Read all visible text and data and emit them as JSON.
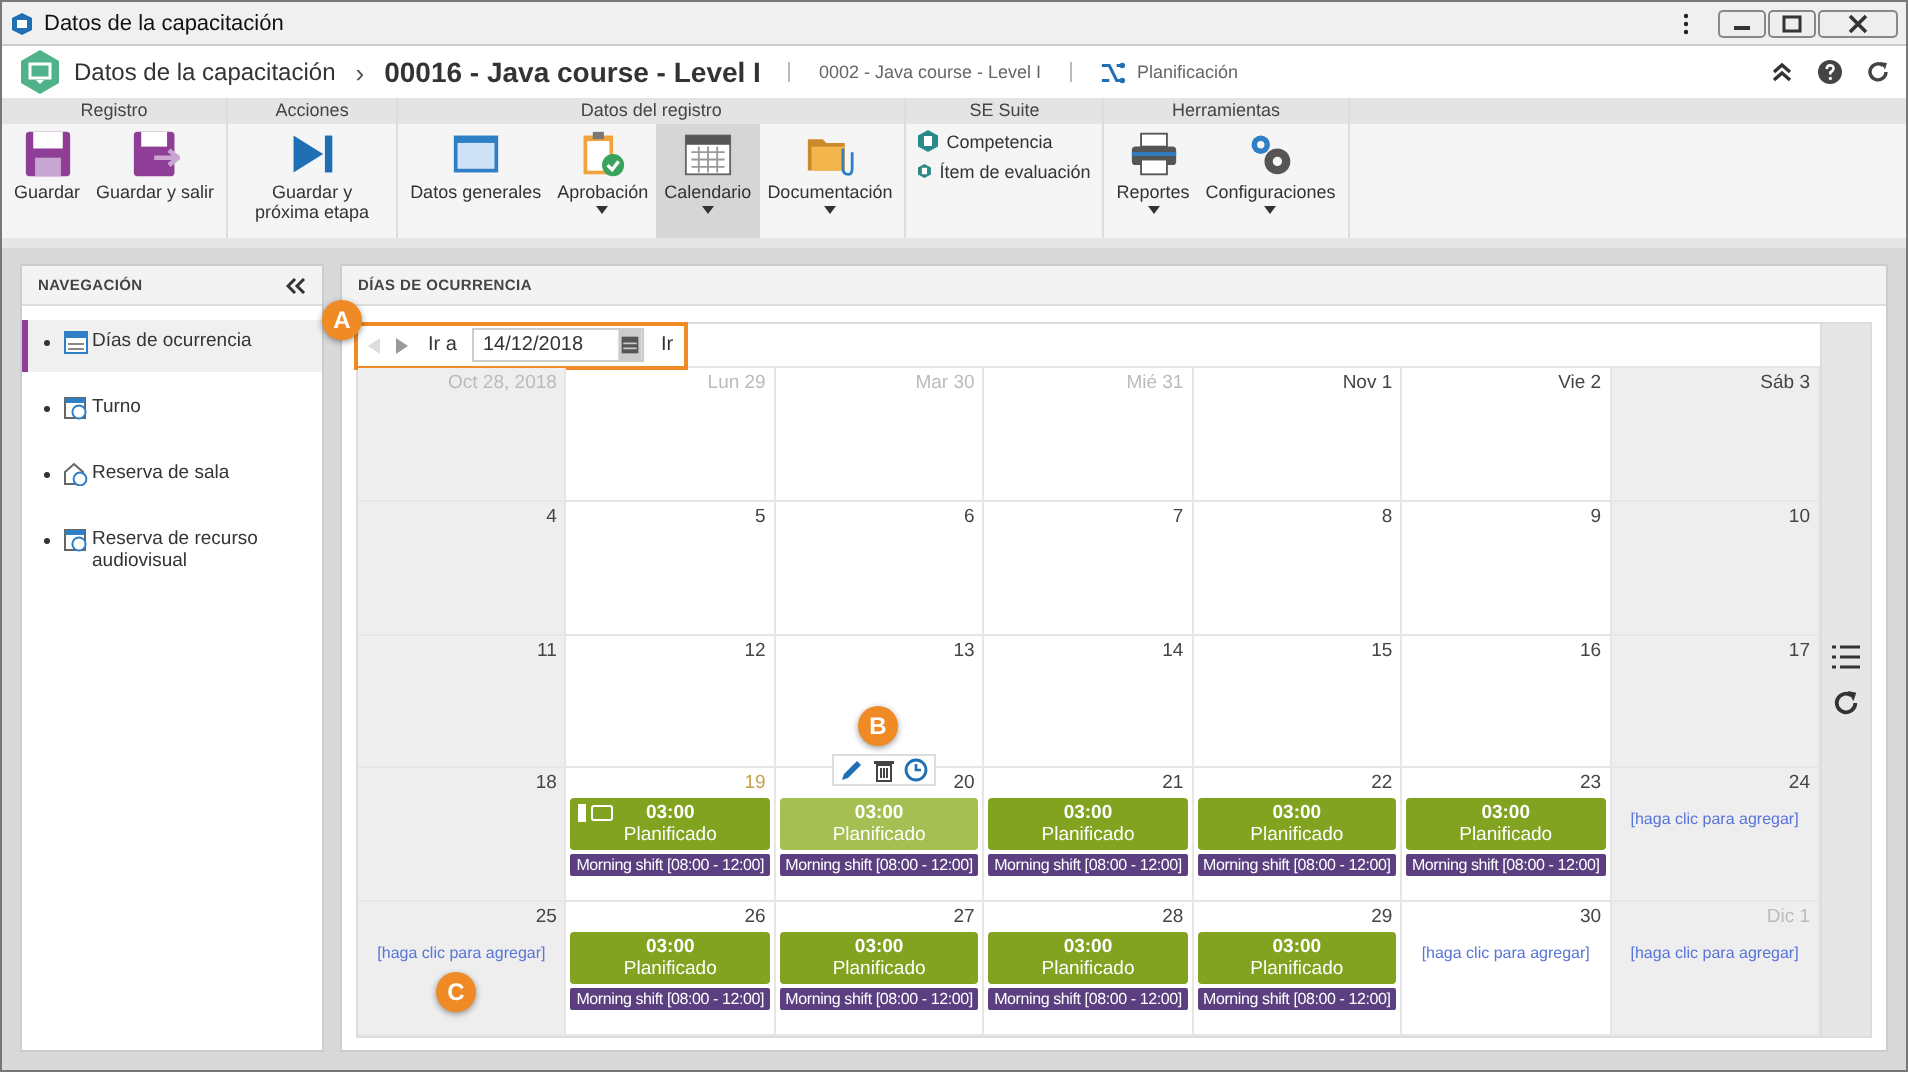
{
  "window": {
    "title": "Datos de la capacitación"
  },
  "header": {
    "breadcrumb": "Datos de la capacitación",
    "separator": "›",
    "record_title": "00016 - Java course - Level I",
    "subtitle": "0002 - Java course - Level I",
    "link": "Planificación"
  },
  "ribbon": [
    {
      "title": "Registro",
      "kind": "large",
      "items": [
        {
          "kind": "save",
          "label": "Guardar",
          "dropdown": false,
          "selected": false
        },
        {
          "kind": "save-exit",
          "label": "Guardar y salir",
          "dropdown": false,
          "selected": false
        }
      ]
    },
    {
      "title": "Acciones",
      "kind": "large",
      "items": [
        {
          "kind": "next",
          "label": "Guardar y próxima etapa",
          "dropdown": false,
          "selected": false
        }
      ]
    },
    {
      "title": "Datos del registro",
      "kind": "large",
      "items": [
        {
          "kind": "general",
          "label": "Datos generales",
          "dropdown": false,
          "selected": false
        },
        {
          "kind": "approval",
          "label": "Aprobación",
          "dropdown": true,
          "selected": false
        },
        {
          "kind": "calendar",
          "label": "Calendario",
          "dropdown": true,
          "selected": true
        },
        {
          "kind": "docs",
          "label": "Documentación",
          "dropdown": true,
          "selected": false
        }
      ]
    },
    {
      "title": "SE Suite",
      "kind": "small",
      "items": [
        {
          "label": "Competencia"
        },
        {
          "label": "Ítem de evaluación"
        }
      ]
    },
    {
      "title": "Herramientas",
      "kind": "large",
      "items": [
        {
          "kind": "print",
          "label": "Reportes",
          "dropdown": true,
          "selected": false
        },
        {
          "kind": "config",
          "label": "Configuraciones",
          "dropdown": true,
          "selected": false
        }
      ]
    }
  ],
  "navigation": {
    "title": "NAVEGACIÓN",
    "items": [
      {
        "kind": "calendar",
        "label": "Días de ocurrencia",
        "selected": true
      },
      {
        "kind": "shift",
        "label": "Turno",
        "selected": false
      },
      {
        "kind": "room",
        "label": "Reserva de sala",
        "selected": false
      },
      {
        "kind": "resource",
        "label": "Reserva de recurso audiovisual",
        "selected": false
      }
    ]
  },
  "main": {
    "title": "DÍAS DE OCURRENCIA",
    "go_label": "Ir a",
    "date": "14/12/2018",
    "go_button": "Ir",
    "weeks": [
      [
        {
          "label": "Oct 28, 2018",
          "muted": true,
          "today": false
        },
        {
          "label": "Lun 29",
          "muted": true,
          "today": false
        },
        {
          "label": "Mar 30",
          "muted": true,
          "today": false
        },
        {
          "label": "Mié 31",
          "muted": true,
          "today": false
        },
        {
          "label": "Nov 1",
          "muted": false,
          "today": false
        },
        {
          "label": "Vie 2",
          "muted": false,
          "today": false
        },
        {
          "label": "Sáb 3",
          "muted": false,
          "today": false
        }
      ],
      [
        {
          "label": "4",
          "muted": false,
          "today": false
        },
        {
          "label": "5",
          "muted": false,
          "today": false
        },
        {
          "label": "6",
          "muted": false,
          "today": false
        },
        {
          "label": "7",
          "muted": false,
          "today": false
        },
        {
          "label": "8",
          "muted": false,
          "today": false
        },
        {
          "label": "9",
          "muted": false,
          "today": false
        },
        {
          "label": "10",
          "muted": false,
          "today": false
        }
      ],
      [
        {
          "label": "11",
          "muted": false,
          "today": false
        },
        {
          "label": "12",
          "muted": false,
          "today": false
        },
        {
          "label": "13",
          "muted": false,
          "today": false
        },
        {
          "label": "14",
          "muted": false,
          "today": false
        },
        {
          "label": "15",
          "muted": false,
          "today": false
        },
        {
          "label": "16",
          "muted": false,
          "today": false
        },
        {
          "label": "17",
          "muted": false,
          "today": false
        }
      ],
      [
        {
          "label": "18",
          "muted": false,
          "today": false
        },
        {
          "label": "19",
          "muted": false,
          "today": true,
          "event": {
            "time": "03:00",
            "status": "Planificado",
            "hover": false,
            "flags": true,
            "shift": "Morning shift [08:00 - 12:00]"
          }
        },
        {
          "label": "20",
          "muted": false,
          "today": false,
          "event": {
            "time": "03:00",
            "status": "Planificado",
            "hover": true,
            "flags": false,
            "shift": "Morning shift [08:00 - 12:00]"
          }
        },
        {
          "label": "21",
          "muted": false,
          "today": false,
          "event": {
            "time": "03:00",
            "status": "Planificado",
            "hover": false,
            "flags": false,
            "shift": "Morning shift [08:00 - 12:00]"
          }
        },
        {
          "label": "22",
          "muted": false,
          "today": false,
          "event": {
            "time": "03:00",
            "status": "Planificado",
            "hover": false,
            "flags": false,
            "shift": "Morning shift [08:00 - 12:00]"
          }
        },
        {
          "label": "23",
          "muted": false,
          "today": false,
          "event": {
            "time": "03:00",
            "status": "Planificado",
            "hover": false,
            "flags": false,
            "shift": "Morning shift [08:00 - 12:00]"
          }
        },
        {
          "label": "24",
          "muted": false,
          "today": false,
          "add": "[haga clic para agregar]"
        }
      ],
      [
        {
          "label": "25",
          "muted": false,
          "today": false,
          "add": "[haga clic para agregar]"
        },
        {
          "label": "26",
          "muted": false,
          "today": false,
          "event": {
            "time": "03:00",
            "status": "Planificado",
            "hover": false,
            "flags": false,
            "shift": "Morning shift [08:00 - 12:00]"
          }
        },
        {
          "label": "27",
          "muted": false,
          "today": false,
          "event": {
            "time": "03:00",
            "status": "Planificado",
            "hover": false,
            "flags": false,
            "shift": "Morning shift [08:00 - 12:00]"
          }
        },
        {
          "label": "28",
          "muted": false,
          "today": false,
          "event": {
            "time": "03:00",
            "status": "Planificado",
            "hover": false,
            "flags": false,
            "shift": "Morning shift [08:00 - 12:00]"
          }
        },
        {
          "label": "29",
          "muted": false,
          "today": false,
          "event": {
            "time": "03:00",
            "status": "Planificado",
            "hover": false,
            "flags": false,
            "shift": "Morning shift [08:00 - 12:00]"
          }
        },
        {
          "label": "30",
          "muted": false,
          "today": false,
          "add": "[haga clic para agregar]"
        },
        {
          "label": "Dic 1",
          "muted": true,
          "today": false,
          "add": "[haga clic para agregar]"
        }
      ]
    ]
  },
  "callouts": [
    {
      "letter": "A"
    },
    {
      "letter": "B"
    },
    {
      "letter": "C"
    }
  ]
}
